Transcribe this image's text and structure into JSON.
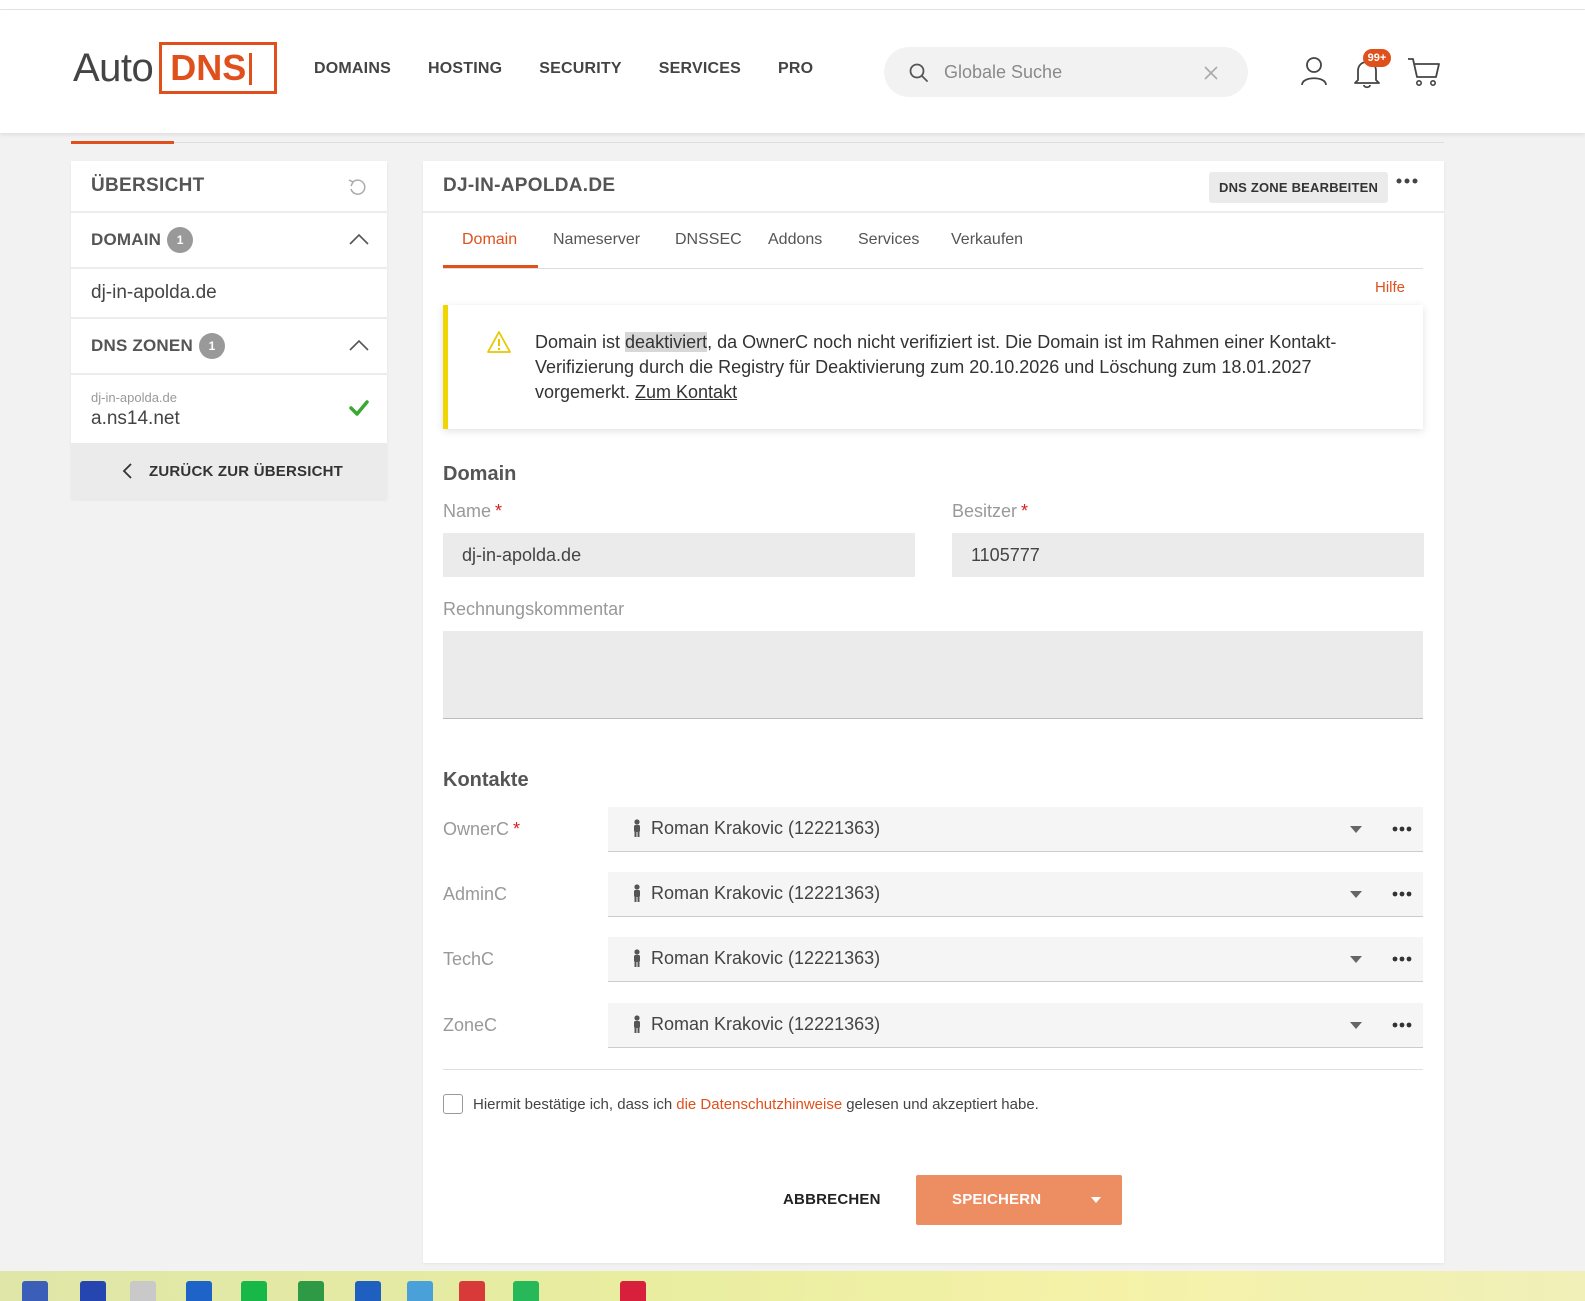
{
  "logo": {
    "auto": "Auto",
    "dns": "DNS"
  },
  "nav": [
    "DOMAINS",
    "HOSTING",
    "SECURITY",
    "SERVICES",
    "PRO"
  ],
  "search": {
    "placeholder": "Globale Suche"
  },
  "notifications": {
    "badge": "99+"
  },
  "sidebar": {
    "title": "ÜBERSICHT",
    "domain_section": {
      "label": "DOMAIN",
      "count": "1",
      "items": [
        "dj-in-apolda.de"
      ]
    },
    "dns_section": {
      "label": "DNS ZONEN",
      "count": "1",
      "zone_domain": "dj-in-apolda.de",
      "zone_ns": "a.ns14.net"
    },
    "back_label": "ZURÜCK ZUR ÜBERSICHT"
  },
  "main": {
    "title": "DJ-IN-APOLDA.DE",
    "edit_zone_label": "DNS ZONE BEARBEITEN",
    "tabs": [
      "Domain",
      "Nameserver",
      "DNSSEC",
      "Addons",
      "Services",
      "Verkaufen"
    ],
    "active_tab": "Domain",
    "help_label": "Hilfe",
    "alert": {
      "part1": "Domain ist ",
      "highlight": "deaktiviert",
      "part2": ", da OwnerC noch nicht verifiziert ist. Die Domain ist im Rahmen einer Kontakt-Verifizierung durch die Registry für Deaktivierung zum 20.10.2026 und Löschung zum 18.01.2027 vorgemerkt. ",
      "link": "Zum Kontakt"
    },
    "domain_section": {
      "title": "Domain",
      "name_label": "Name",
      "name_value": "dj-in-apolda.de",
      "owner_label": "Besitzer",
      "owner_value": "1105777",
      "comment_label": "Rechnungskommentar",
      "comment_value": ""
    },
    "contacts_section": {
      "title": "Kontakte",
      "rows": [
        {
          "label": "OwnerC",
          "required": true,
          "value": "Roman Krakovic (12221363)"
        },
        {
          "label": "AdminC",
          "required": false,
          "value": "Roman Krakovic (12221363)"
        },
        {
          "label": "TechC",
          "required": false,
          "value": "Roman Krakovic (12221363)"
        },
        {
          "label": "ZoneC",
          "required": false,
          "value": "Roman Krakovic (12221363)"
        }
      ]
    },
    "consent": {
      "before": "Hiermit bestätige ich, dass ich",
      "link": "die Datenschutzhinweise",
      "after": "gelesen und akzeptiert habe.",
      "checked": false
    },
    "cancel_label": "ABBRECHEN",
    "save_label": "SPEICHERN"
  },
  "colors": {
    "accent": "#e0501c",
    "save_button": "#ec8e62",
    "warning": "#f0d600",
    "success": "#3aa832"
  }
}
